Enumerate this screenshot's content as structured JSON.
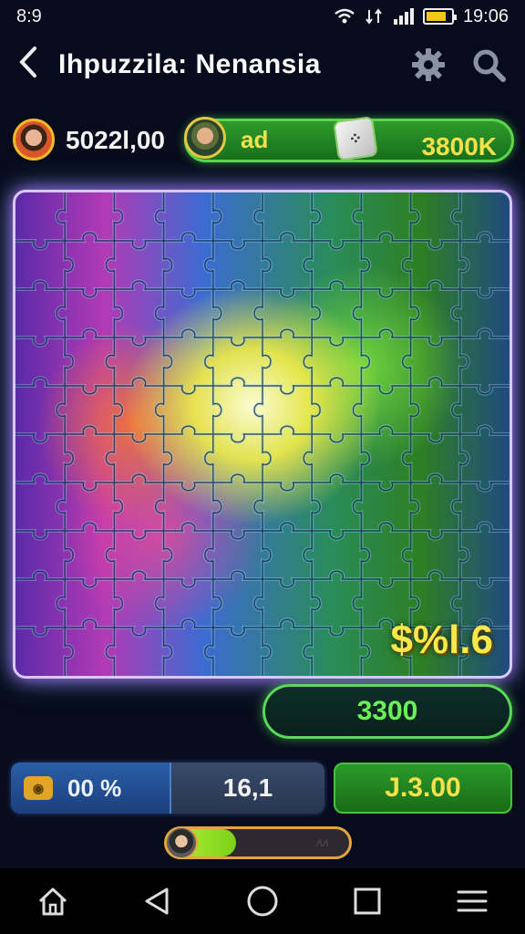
{
  "status_bar": {
    "time_left": "8:9",
    "time_right": "19:06"
  },
  "header": {
    "title": "Ihpuzzila: Nenansia",
    "settings_icon": "gear-icon",
    "search_icon": "search-icon"
  },
  "scores": {
    "player_score": "5022l,00",
    "ad_label": "ad",
    "coins": "3800K"
  },
  "board": {
    "streak_label": "$%l.6",
    "rows": 10,
    "cols": 10
  },
  "bonus": {
    "value": "3300"
  },
  "stats": {
    "left_value": "00 %",
    "right_value": "16,1",
    "gold_value": "J.3.00"
  },
  "progress": {
    "label": "ᴧᴧ",
    "fill_fraction": 0.38
  },
  "colors": {
    "accent_green": "#58d957",
    "gold": "#f5e24a",
    "board_glow": "#a86cff"
  },
  "navbar": [
    "home-icon",
    "back-triangle-icon",
    "home-circle-icon",
    "recents-square-icon",
    "menu-icon"
  ]
}
